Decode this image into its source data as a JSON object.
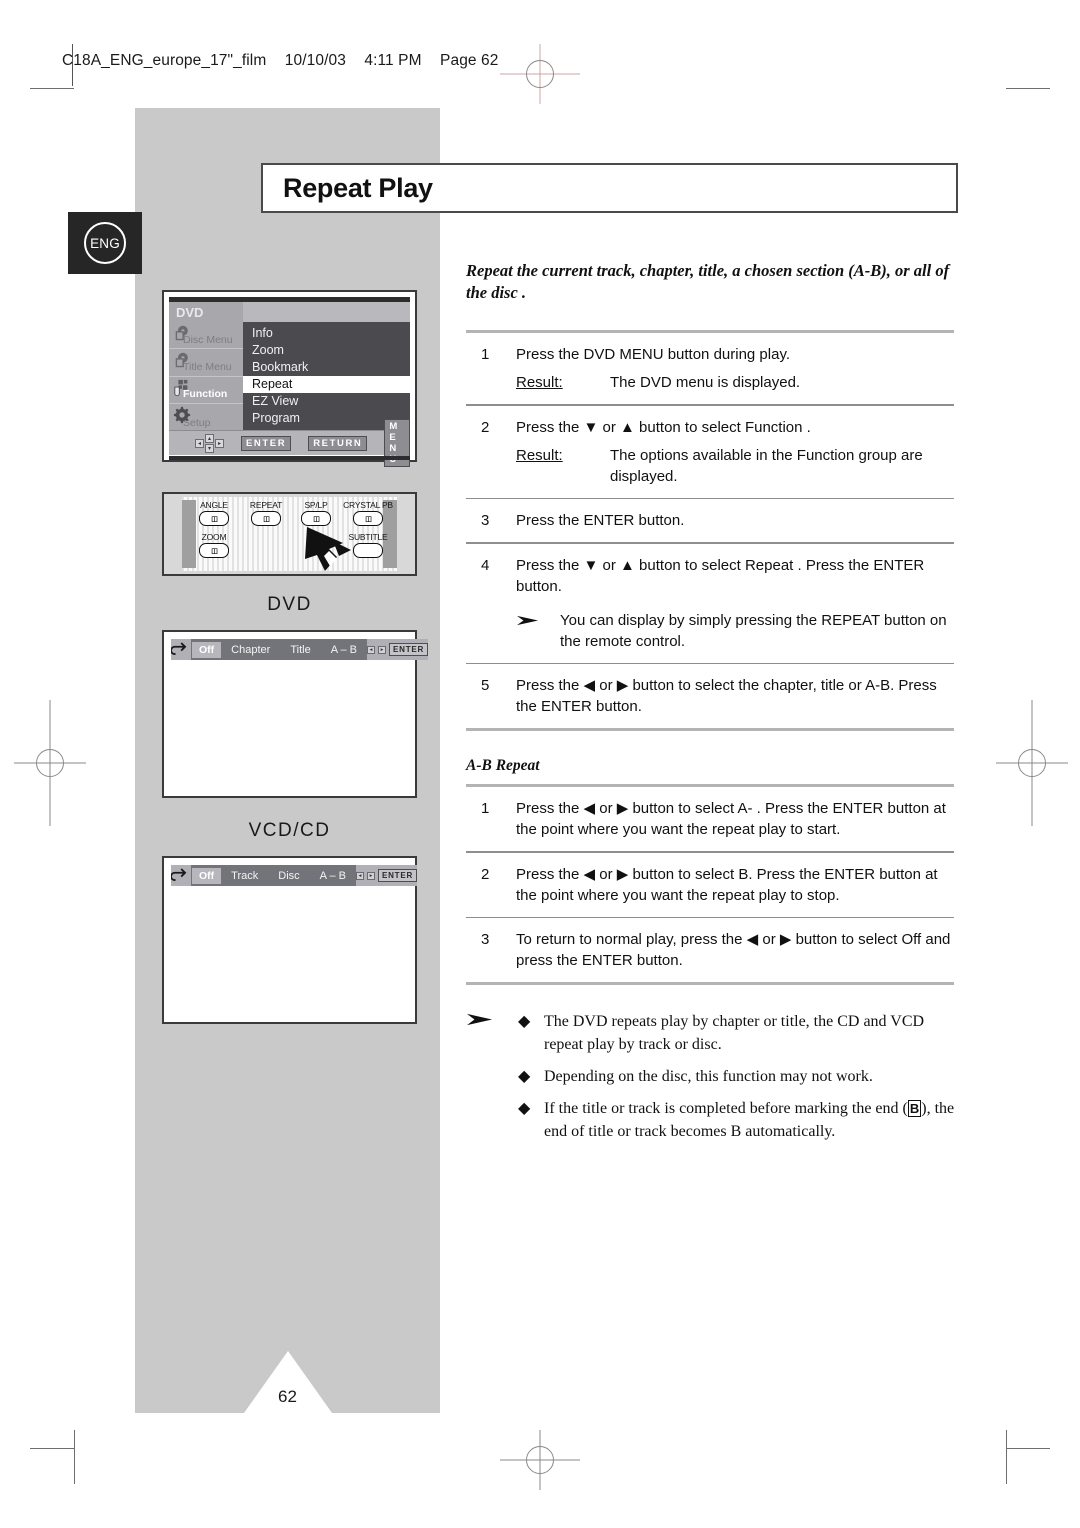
{
  "slug": {
    "file": "C18A_ENG_europe_17\"_film",
    "date": "10/10/03",
    "time": "4:11 PM",
    "page": "Page 62"
  },
  "page": {
    "number": "62",
    "language_badge": "ENG"
  },
  "title": "Repeat Play",
  "lead": "Repeat the current track, chapter, title, a chosen section (A-B), or all of the disc .",
  "osd_menu": {
    "header": "DVD",
    "sidebar": [
      {
        "label": "Disc Menu",
        "icon": "disc-menu-icon",
        "active": false
      },
      {
        "label": "Title Menu",
        "icon": "title-menu-icon",
        "active": false
      },
      {
        "label": "Function",
        "icon": "function-icon",
        "active": true
      },
      {
        "label": "Setup",
        "icon": "gear-icon",
        "active": false
      }
    ],
    "options": [
      {
        "label": "Info",
        "selected": false
      },
      {
        "label": "Zoom",
        "selected": false
      },
      {
        "label": "Bookmark",
        "selected": false
      },
      {
        "label": "Repeat",
        "selected": true
      },
      {
        "label": "EZ View",
        "selected": false
      },
      {
        "label": "Program",
        "selected": false
      }
    ],
    "buttons": [
      "ENTER",
      "RETURN",
      "M E N U"
    ]
  },
  "remote": {
    "keys_top": [
      "ANGLE",
      "REPEAT",
      "SP/LP",
      "CRYSTAL PB"
    ],
    "keys_bottom": [
      "ZOOM",
      "SUBTITLE"
    ],
    "pointer": "arrow-pointer-to-repeat"
  },
  "dvd_panel": {
    "caption": "DVD",
    "icon": "repeat-cycle-icon",
    "state": "Off",
    "options": [
      "Chapter",
      "Title",
      "A  –  B"
    ],
    "enter": "ENTER"
  },
  "vcd_panel": {
    "caption": "VCD/CD",
    "icon": "repeat-cycle-icon",
    "state": "Off",
    "options": [
      "Track",
      "Disc",
      "A  –  B"
    ],
    "enter": "ENTER"
  },
  "steps": [
    {
      "no": "1",
      "body": "Press the DVD MENU button during play.",
      "result_key": "Result:",
      "result": "The DVD menu is displayed."
    },
    {
      "no": "2",
      "body": "Press the ▼ or ▲ button to select Function   .",
      "result_key": "Result:",
      "result": "The options available in the Function    group are displayed."
    },
    {
      "no": "3",
      "body": "Press the ENTER button."
    },
    {
      "no": "4",
      "body": "Press the ▼ or ▲ button to select Repeat . Press the ENTER button.",
      "note": "You can display by simply pressing the REPEAT button on the remote control."
    },
    {
      "no": "5",
      "body": "Press the ◀ or ▶ button to select the chapter, title or A-B. Press the ENTER button."
    }
  ],
  "ab_repeat": {
    "heading": "A-B Repeat",
    "steps": [
      {
        "no": "1",
        "body": "Press the ◀ or ▶ button to select A- . Press the ENTER button at the point where you want the repeat play to start."
      },
      {
        "no": "2",
        "body": "Press the ◀ or ▶ button to select B. Press the ENTER button at the point where you want the repeat play to stop."
      },
      {
        "no": "3",
        "body": "To return to normal play, press the ◀ or ▶ button to select Off and press the ENTER button."
      }
    ]
  },
  "footnotes": [
    {
      "pre": "The DVD repeats play by chapter or title, the CD and VCD repeat play by track or disc.",
      "boxed": "",
      "post": ""
    },
    {
      "pre": "Depending on the disc, this function may not work.",
      "boxed": "",
      "post": ""
    },
    {
      "pre": "If the title or track is completed before marking the end (",
      "boxed": "B",
      "post": "), the end of title or track becomes B automatically."
    }
  ]
}
